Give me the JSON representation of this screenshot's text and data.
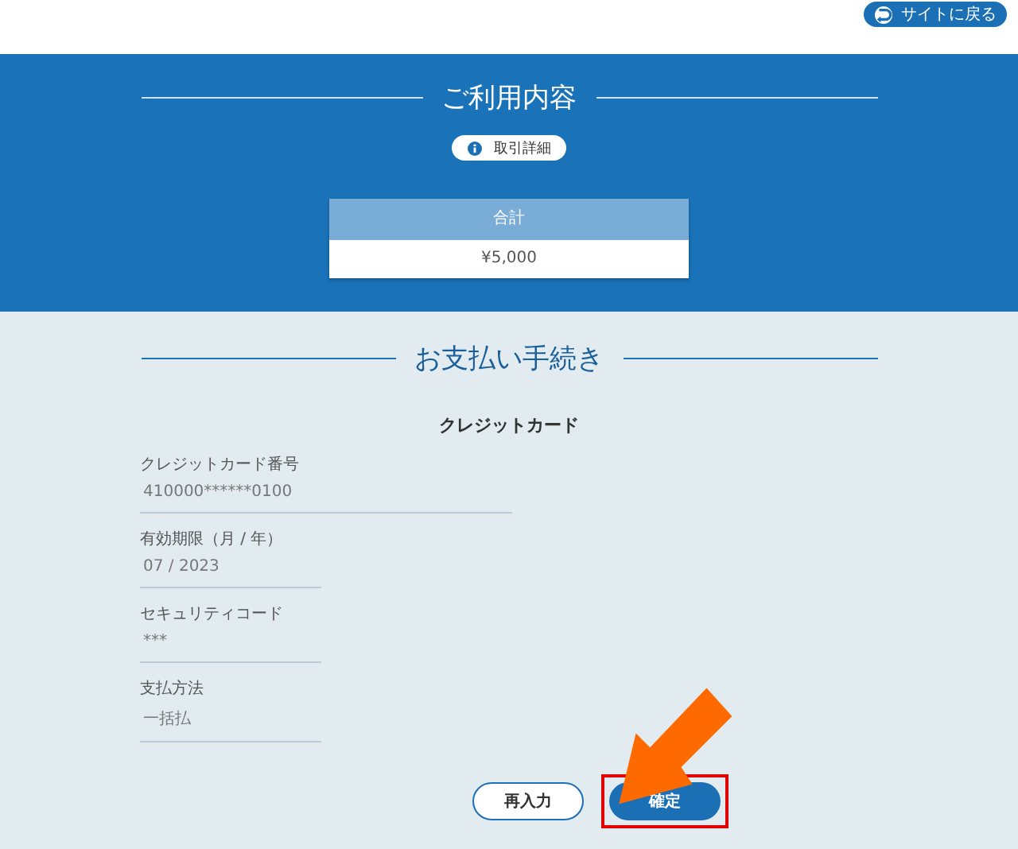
{
  "header": {
    "back_button": "サイトに戻る"
  },
  "usage": {
    "title": "ご利用内容",
    "details_button": "取引詳細",
    "summary": {
      "heading": "合計",
      "amount": "¥5,000"
    }
  },
  "payment": {
    "title": "お支払い手続き",
    "method_title": "クレジットカード",
    "fields": [
      {
        "kind": "long",
        "label": "クレジットカード番号",
        "value": "410000******0100"
      },
      {
        "kind": "short",
        "label": "有効期限（月 / 年）",
        "value": "07 / 2023"
      },
      {
        "kind": "short",
        "label": "セキュリティコード",
        "value": "***"
      },
      {
        "kind": "short",
        "label": "支払方法",
        "value": "一括払"
      }
    ]
  },
  "buttons": [
    {
      "kind": "secondary",
      "label": "再入力",
      "highlighted": false
    },
    {
      "kind": "primary",
      "label": "確定",
      "highlighted": true
    }
  ]
}
